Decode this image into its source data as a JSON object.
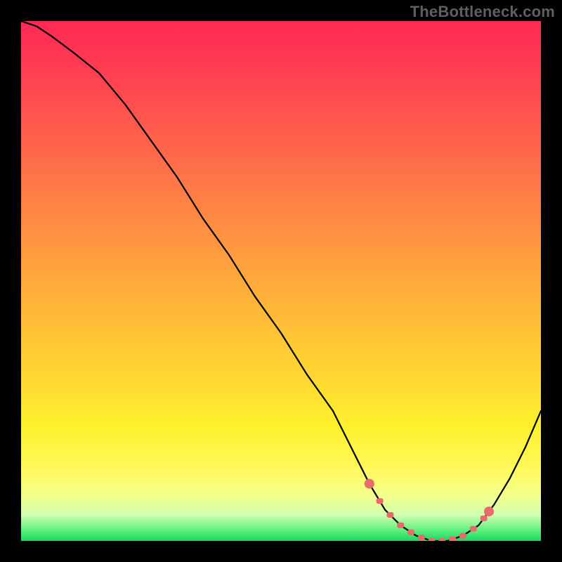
{
  "watermark": "TheBottleneck.com",
  "colors": {
    "background": "#000000",
    "curve": "#000000",
    "marker": "#e86a6a"
  },
  "chart_data": {
    "type": "line",
    "title": "",
    "xlabel": "",
    "ylabel": "",
    "xlim": [
      0,
      100
    ],
    "ylim": [
      0,
      100
    ],
    "grid": false,
    "legend": false,
    "note": "Background is a vertical heat gradient (red=bad, green=good). Curve shows bottleneck percentage vs a hidden horizontal parameter. Values estimated from pixel positions on a 0–100 scale; no axis ticks are drawn in the source image.",
    "gradient_stops": [
      {
        "pos": 0,
        "color": "#ff2a55"
      },
      {
        "pos": 20,
        "color": "#ff5a4d"
      },
      {
        "pos": 44,
        "color": "#ff9a40"
      },
      {
        "pos": 68,
        "color": "#ffd632"
      },
      {
        "pos": 86,
        "color": "#fff95a"
      },
      {
        "pos": 95,
        "color": "#d2ffb0"
      },
      {
        "pos": 100,
        "color": "#18d85e"
      }
    ],
    "series": [
      {
        "name": "bottleneck-curve",
        "x": [
          0,
          3,
          6,
          10,
          15,
          20,
          25,
          30,
          35,
          40,
          45,
          50,
          55,
          60,
          64,
          67,
          70,
          73,
          76,
          79,
          82,
          85,
          88,
          91,
          94,
          97,
          100
        ],
        "y": [
          100,
          99,
          97,
          94,
          90,
          84,
          77,
          70,
          62,
          55,
          47,
          40,
          32,
          25,
          17,
          11,
          6,
          3,
          1,
          0,
          0,
          1,
          3,
          7,
          12,
          18,
          25
        ]
      }
    ],
    "highlight_band": {
      "name": "optimal-range",
      "x_start": 67,
      "x_end": 90,
      "marker_xs": [
        67,
        69,
        71,
        73,
        75,
        77,
        79,
        81,
        83,
        85,
        87,
        89,
        90
      ]
    }
  }
}
